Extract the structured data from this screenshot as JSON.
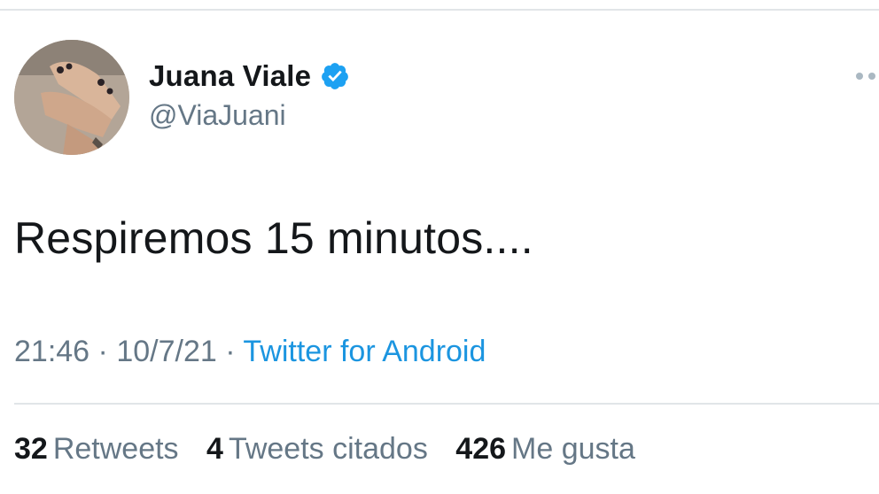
{
  "tweet": {
    "author": {
      "display_name": "Juana Viale",
      "handle": "@ViaJuani",
      "verified": true
    },
    "text": "Respiremos 15 minutos....",
    "time": "21:46",
    "date": "10/7/21",
    "separator": "·",
    "source": "Twitter for Android",
    "stats": [
      {
        "count": "32",
        "label": "Retweets"
      },
      {
        "count": "4",
        "label": "Tweets citados"
      },
      {
        "count": "426",
        "label": "Me gusta"
      }
    ]
  },
  "colors": {
    "verified": "#1da1f2",
    "source_link": "#1b95e0",
    "secondary_text": "#657786",
    "divider": "#e1e5e8"
  }
}
